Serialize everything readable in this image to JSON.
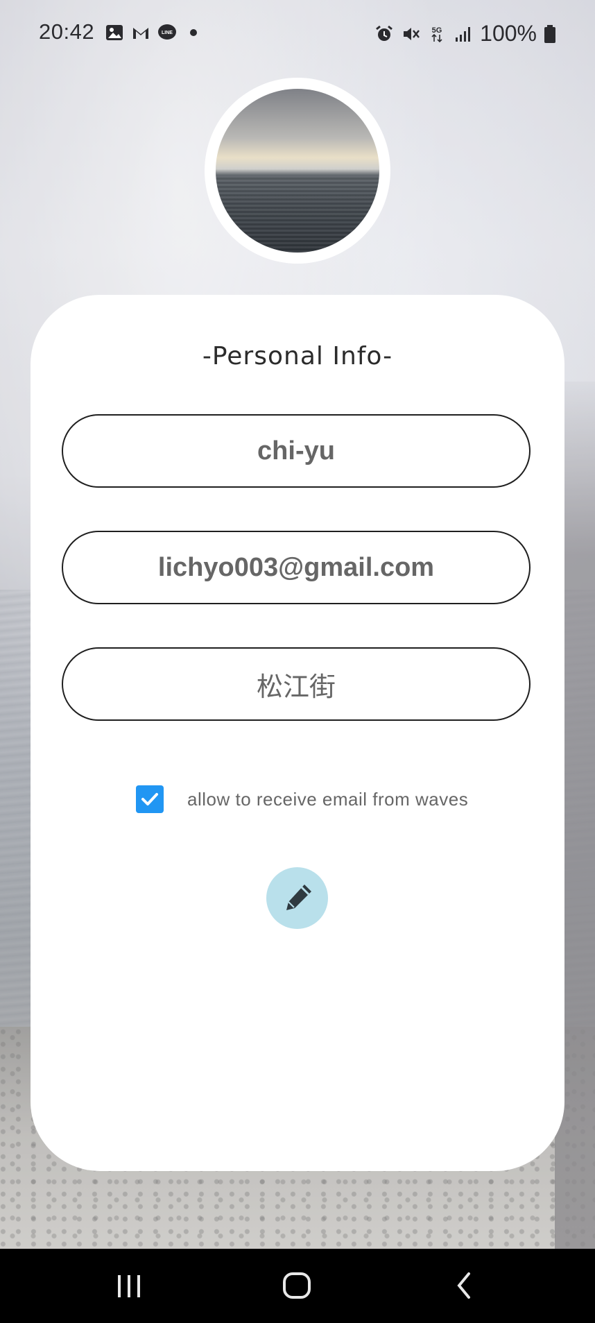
{
  "status_bar": {
    "time": "20:42",
    "battery": "100%",
    "left_icons": [
      "gallery-icon",
      "gmail-icon",
      "line-icon",
      "dot-icon"
    ],
    "right_icons": [
      "alarm-icon",
      "mute-icon",
      "5g-icon",
      "signal-icon",
      "battery-icon"
    ]
  },
  "profile": {
    "avatar": "sea-sunset-photo"
  },
  "card": {
    "title": "-Personal Info-",
    "fields": {
      "name": "chi-yu",
      "email": "lichyo003@gmail.com",
      "address": "松江街"
    },
    "checkbox": {
      "checked": true,
      "label": "allow to receive email from waves"
    },
    "edit_icon": "pencil-icon"
  },
  "nav_bar": {
    "items": [
      "recent-apps-icon",
      "home-icon",
      "back-icon"
    ]
  },
  "colors": {
    "accent": "#2196f3",
    "edit_button": "#b9e0eb",
    "card": "#ffffff"
  }
}
